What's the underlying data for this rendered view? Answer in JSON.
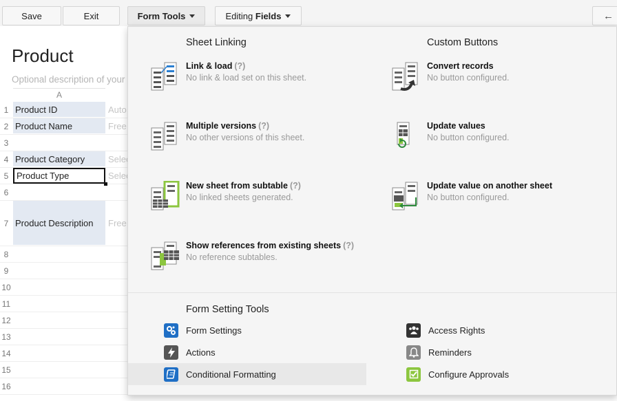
{
  "toolbar": {
    "save": "Save",
    "exit": "Exit",
    "form_tools": "Form Tools",
    "editing_prefix": "Editing",
    "editing_bold": "Fields",
    "back_arrow": "←"
  },
  "form": {
    "title": "Product",
    "description": "Optional description of your",
    "column_header": "A",
    "rows": [
      {
        "num": "1",
        "label": "Product ID",
        "value": "Auto"
      },
      {
        "num": "2",
        "label": "Product Name",
        "value": "Free"
      },
      {
        "num": "3",
        "label": "",
        "value": ""
      },
      {
        "num": "4",
        "label": "Product Category",
        "value": "Selec"
      },
      {
        "num": "5",
        "label": "Product Type",
        "value": "Selec"
      },
      {
        "num": "6",
        "label": "",
        "value": ""
      },
      {
        "num": "7",
        "label": "Product Description",
        "value": "Free"
      },
      {
        "num": "8",
        "label": "",
        "value": ""
      },
      {
        "num": "9",
        "label": "",
        "value": ""
      },
      {
        "num": "10",
        "label": "",
        "value": ""
      },
      {
        "num": "11",
        "label": "",
        "value": ""
      },
      {
        "num": "12",
        "label": "",
        "value": ""
      },
      {
        "num": "13",
        "label": "",
        "value": ""
      },
      {
        "num": "14",
        "label": "",
        "value": ""
      },
      {
        "num": "15",
        "label": "",
        "value": ""
      },
      {
        "num": "16",
        "label": "",
        "value": ""
      }
    ]
  },
  "menu": {
    "sheet_linking": {
      "heading": "Sheet Linking",
      "items": [
        {
          "name": "Link & load",
          "help": "(?)",
          "sub": "No link & load set on this sheet.",
          "icon": "link-load-icon"
        },
        {
          "name": "Multiple versions",
          "help": "(?)",
          "sub": "No other versions of this sheet.",
          "icon": "multiple-versions-icon"
        },
        {
          "name": "New sheet from subtable",
          "help": "(?)",
          "sub": "No linked sheets generated.",
          "icon": "subtable-sheet-icon"
        },
        {
          "name": "Show references from existing sheets",
          "help": "(?)",
          "sub": "No reference subtables.",
          "icon": "references-icon"
        }
      ]
    },
    "custom_buttons": {
      "heading": "Custom Buttons",
      "items": [
        {
          "name": "Convert records",
          "sub": "No button configured.",
          "icon": "convert-records-icon"
        },
        {
          "name": "Update values",
          "sub": "No button configured.",
          "icon": "update-values-icon"
        },
        {
          "name": "Update value on another sheet",
          "sub": "No button configured.",
          "icon": "update-another-sheet-icon"
        }
      ]
    },
    "form_setting_tools": {
      "heading": "Form Setting Tools",
      "left": [
        {
          "label": "Form Settings",
          "icon": "gears-icon",
          "color": "#1f6fc5"
        },
        {
          "label": "Actions",
          "icon": "lightning-icon",
          "color": "#555555"
        },
        {
          "label": "Conditional Formatting",
          "icon": "notebook-icon",
          "color": "#1f6fc5"
        }
      ],
      "right": [
        {
          "label": "Access Rights",
          "icon": "users-icon",
          "color": "#333333"
        },
        {
          "label": "Reminders",
          "icon": "bell-icon",
          "color": "#888888"
        },
        {
          "label": "Configure Approvals",
          "icon": "checkbox-icon",
          "color": "#8cc63f"
        }
      ]
    }
  }
}
